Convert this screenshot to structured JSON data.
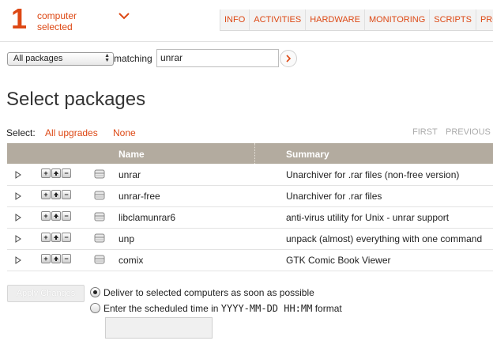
{
  "header": {
    "count": "1",
    "count_label_line1": "computer",
    "count_label_line2": "selected",
    "dropdown_icon": "chevron-down-icon",
    "accent_color": "#dd4814",
    "tabs": [
      {
        "label": "INFO"
      },
      {
        "label": "ACTIVITIES"
      },
      {
        "label": "HARDWARE"
      },
      {
        "label": "MONITORING"
      },
      {
        "label": "SCRIPTS"
      },
      {
        "label": "PROCE"
      }
    ]
  },
  "search": {
    "filter_selected": "All packages",
    "matching_label": "matching",
    "term_value": "unrar",
    "go_icon": "chevron-right-icon"
  },
  "page_title": "Select packages",
  "select_bar": {
    "label": "Select:",
    "all_upgrades": "All upgrades",
    "none": "None",
    "first": "FIRST",
    "previous": "PREVIOUS"
  },
  "table": {
    "columns": {
      "name": "Name",
      "summary": "Summary"
    },
    "rows": [
      {
        "name": "unrar",
        "summary": "Unarchiver for .rar files (non-free version)"
      },
      {
        "name": "unrar-free",
        "summary": "Unarchiver for .rar files"
      },
      {
        "name": "libclamunrar6",
        "summary": "anti-virus utility for Unix - unrar support"
      },
      {
        "name": "unp",
        "summary": "unpack (almost) everything with one command"
      },
      {
        "name": "comix",
        "summary": "GTK Comic Book Viewer"
      }
    ]
  },
  "actions": {
    "apply_label": "Apply Changes",
    "deliver_option": "Deliver to selected computers as soon as possible",
    "deliver_selected": true,
    "schedule_prefix": "Enter the scheduled time in",
    "schedule_format": "YYYY-MM-DD HH:MM",
    "schedule_suffix": "format",
    "schedule_value": ""
  }
}
